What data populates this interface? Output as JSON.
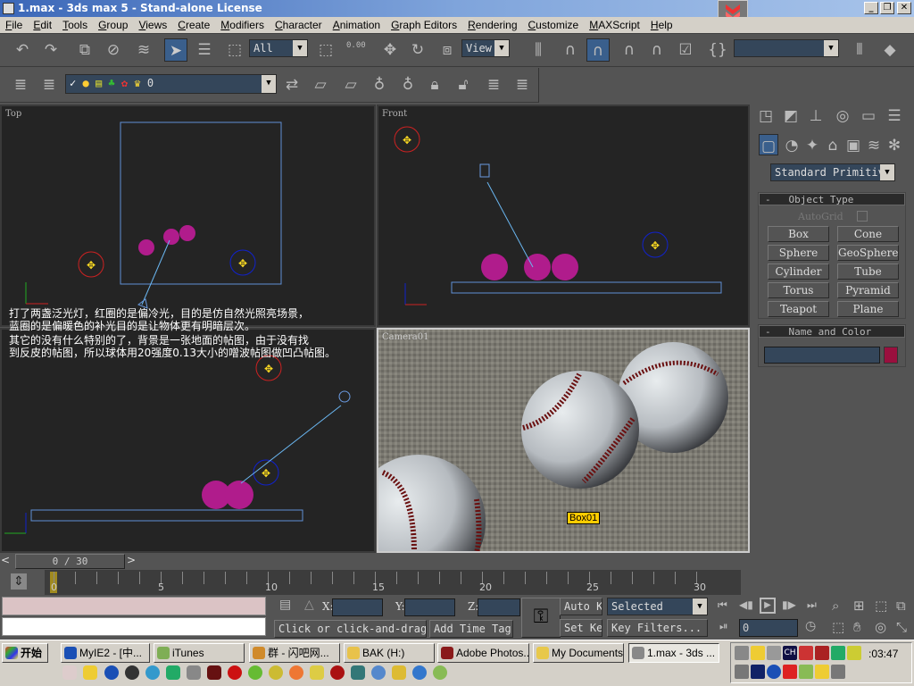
{
  "window": {
    "title": "1.max - 3ds max 5 - Stand-alone License",
    "minimize": "_",
    "restore": "❐",
    "close": "✕"
  },
  "menu": [
    "File",
    "Edit",
    "Tools",
    "Group",
    "Views",
    "Create",
    "Modifiers",
    "Character",
    "Animation",
    "Graph Editors",
    "Rendering",
    "Customize",
    "MAXScript",
    "Help"
  ],
  "toolbar": {
    "selection_filter": "All",
    "spinner_value": "0.00",
    "ref_coord": "View",
    "named_selection": ""
  },
  "layers": {
    "current_layer": "0"
  },
  "viewports": {
    "top": {
      "label": "Top"
    },
    "front": {
      "label": "Front"
    },
    "left": {
      "label": ""
    },
    "camera": {
      "label": "Camera01",
      "tooltip": "Box01"
    }
  },
  "overlay_text": [
    "打了两盏泛光灯，红圈的是偏冷光，目的是仿自然光照亮场景，",
    "蓝圈的是偏暖色的补光目的是让物体更有明暗层次。",
    "其它的没有什么特别的了，背景是一张地面的帖图，由于没有找",
    "到反皮的帖图，所以球体用20强度0.13大小的噌波帖图做凹凸帖图。"
  ],
  "command_panel": {
    "category": "Standard Primitiv",
    "object_type_title": "Object Type",
    "autogrid_label": "AutoGrid",
    "buttons": [
      "Box",
      "Cone",
      "Sphere",
      "GeoSphere",
      "Cylinder",
      "Tube",
      "Torus",
      "Pyramid",
      "Teapot",
      "Plane"
    ],
    "name_color_title": "Name and Color",
    "object_name": "",
    "object_color": "#9a0f3e"
  },
  "time_slider": {
    "label": "0 / 30",
    "current": 0,
    "total": 30
  },
  "track": {
    "ticks": [
      "0",
      "5",
      "10",
      "15",
      "20",
      "25",
      "30"
    ]
  },
  "status": {
    "x_label": "X:",
    "y_label": "Y:",
    "z_label": "Z:",
    "x_value": "",
    "y_value": "",
    "z_value": "",
    "prompt": "Click or click-and-drag",
    "add_time_tag": "Add Time Tag",
    "auto_key": "Auto Key",
    "set_key": "Set Key",
    "key_mode": "Selected",
    "key_filters": "Key Filters...",
    "frame_field": "0"
  },
  "taskbar": {
    "start": "开始",
    "tasks": [
      {
        "label": "MyIE2 - [中...",
        "color": "#1a4fb5"
      },
      {
        "label": "iTunes",
        "color": "#7fae55"
      },
      {
        "label": "群 - 闪吧网...",
        "color": "#d08a2a"
      },
      {
        "label": "BAK (H:)",
        "color": "#e8c24a"
      },
      {
        "label": "Adobe Photos...",
        "color": "#8a1a1a"
      },
      {
        "label": "My Documents",
        "color": "#e8c84a"
      },
      {
        "label": "1.max - 3ds ...",
        "color": "#888"
      }
    ],
    "clock": ":03:47",
    "tray_lang": "CH"
  }
}
